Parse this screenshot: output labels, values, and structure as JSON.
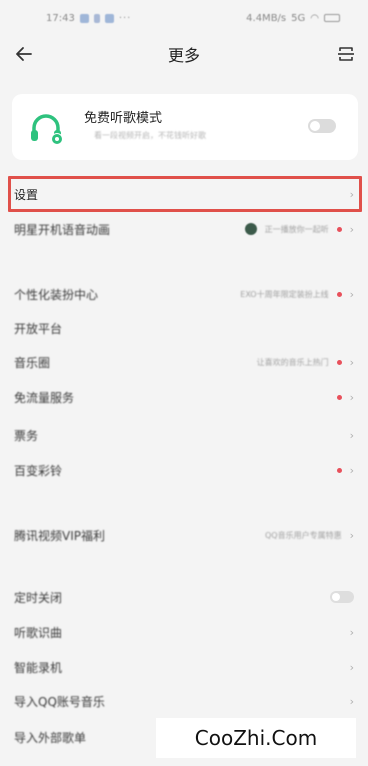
{
  "status_bar": {
    "time": "17:43",
    "network": "4.4MB/s",
    "signal": "5G"
  },
  "header": {
    "title": "更多"
  },
  "free_mode": {
    "title": "免费听歌模式",
    "subtitle": "看一段视频开启，不花钱听好歌",
    "enabled": false
  },
  "rows": [
    {
      "label": "设置",
      "value": "",
      "dot": false,
      "chevron": true,
      "toggle": false
    },
    {
      "label": "明星开机语音动画",
      "value": "正一播放你一起听",
      "dot": true,
      "chevron": true,
      "toggle": false,
      "avatar": true
    },
    {
      "label": "个性化装扮中心",
      "value": "EXO十周年限定装扮上线",
      "dot": true,
      "chevron": true,
      "toggle": false
    },
    {
      "label": "开放平台",
      "value": "",
      "dot": false,
      "chevron": false,
      "toggle": false
    },
    {
      "label": "音乐圈",
      "value": "让喜欢的音乐上热门",
      "dot": true,
      "chevron": true,
      "toggle": false
    },
    {
      "label": "免流量服务",
      "value": "",
      "dot": true,
      "chevron": true,
      "toggle": false
    },
    {
      "label": "票务",
      "value": "",
      "dot": false,
      "chevron": true,
      "toggle": false
    },
    {
      "label": "百变彩铃",
      "value": "",
      "dot": true,
      "chevron": true,
      "toggle": false
    },
    {
      "label": "腾讯视频VIP福利",
      "value": "QQ音乐用户专属特惠",
      "dot": false,
      "chevron": true,
      "toggle": false
    },
    {
      "label": "定时关闭",
      "value": "",
      "dot": false,
      "chevron": false,
      "toggle": true
    },
    {
      "label": "听歌识曲",
      "value": "",
      "dot": false,
      "chevron": true,
      "toggle": false
    },
    {
      "label": "智能录机",
      "value": "",
      "dot": false,
      "chevron": true,
      "toggle": false
    },
    {
      "label": "导入QQ账号音乐",
      "value": "",
      "dot": false,
      "chevron": true,
      "toggle": false
    },
    {
      "label": "导入外部歌单",
      "value": "",
      "dot": false,
      "chevron": true,
      "toggle": false
    }
  ],
  "watermark": {
    "text": "CooZhi.Com"
  },
  "colors": {
    "accent_green": "#2ec27e",
    "highlight_red": "#e0504a",
    "dot_red": "#e8505b"
  }
}
